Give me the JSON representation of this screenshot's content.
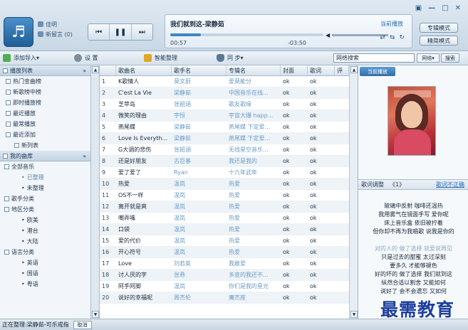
{
  "window": {
    "controls": [
      "▣",
      "—",
      "□",
      "✕"
    ],
    "mode_buttons": [
      "专辑模式",
      "精简模式"
    ]
  },
  "user": {
    "name": "佳明",
    "messages": "新留言 (0)"
  },
  "transport": {
    "prev": "⏮",
    "pause": "❚❚",
    "next": "⏭"
  },
  "now_playing": {
    "title": "我们就到这-梁静茹",
    "lyric_link": "当前播放",
    "time_elapsed": "00:57",
    "time_remaining": "-03:50",
    "progress": 0.2,
    "mode_icons": [
      "⇄",
      "⇆",
      "↻"
    ]
  },
  "toolbar": {
    "add_label": "添加导入▾",
    "settings_label": "设 置",
    "organize_label": "智能整理",
    "sync_label": "同 步▾",
    "search_value": "网络搜索",
    "search_scope": "网络▾",
    "search_button": "搜索"
  },
  "sidebar": {
    "playlist_header": "播放列表",
    "collapse": "»",
    "playlist_items": [
      "热门金曲榜",
      "新歌榜中榜",
      "即时播放榜",
      "最近播放",
      "最常播放",
      "最近添加",
      "新列表"
    ],
    "library_header": "我的曲库",
    "library_items": [
      {
        "label": "全部音乐",
        "level": 1
      },
      {
        "label": "已整理",
        "level": 2
      },
      {
        "label": "未整理",
        "level": 2
      },
      {
        "label": "歌手分类",
        "level": 1
      },
      {
        "label": "地区分类",
        "level": 1
      },
      {
        "label": "欧美",
        "level": 2
      },
      {
        "label": "港台",
        "level": 2
      },
      {
        "label": "大陆",
        "level": 2
      },
      {
        "label": "语言分类",
        "level": 1
      },
      {
        "label": "英语",
        "level": 2
      },
      {
        "label": "国语",
        "level": 2
      },
      {
        "label": "粤语",
        "level": 2
      }
    ]
  },
  "table": {
    "columns": [
      "歌曲名",
      "歌手名",
      "专辑名",
      "封面",
      "歌词",
      "评"
    ],
    "rows": [
      [
        "1",
        "K歌情人",
        "莫文蔚",
        "爱莫能分",
        "ok",
        "ok"
      ],
      [
        "2",
        "C'est La Vie",
        "梁静茹",
        "中国音乐在线...",
        "ok",
        "ok"
      ],
      [
        "3",
        "芝苹岛",
        "张韶涵",
        "歌友歌缘",
        "ok",
        "ok"
      ],
      [
        "4",
        "微笑的理由",
        "宇恒",
        "宇宙大爆 happ...",
        "ok",
        "ok"
      ],
      [
        "5",
        "燕尾蝶",
        "梁静茹",
        "燕尾蝶 下定爱...",
        "ok",
        "ok"
      ],
      [
        "6",
        "Love Is Everyth...",
        "梁静茹",
        "燕尾蝶 下定爱...",
        "ok",
        "ok"
      ],
      [
        "7",
        "G大调的悲伤",
        "张韶涵",
        "无线星空音乐...",
        "ok",
        "ok"
      ],
      [
        "8",
        "还是好朋友",
        "古巨基",
        "我还是我的",
        "ok",
        "ok"
      ],
      [
        "9",
        "爱了爱了",
        "Ryan",
        "十六年武年",
        "ok",
        "ok"
      ],
      [
        "10",
        "热爱",
        "温岚",
        "热爱",
        "ok",
        "ok"
      ],
      [
        "11",
        "OS不一样",
        "温岚",
        "热爱",
        "ok",
        "ok"
      ],
      [
        "12",
        "离开就是爽",
        "温岚",
        "热爱",
        "ok",
        "ok"
      ],
      [
        "13",
        "嘲弄嘴",
        "温岚",
        "热爱",
        "ok",
        "ok"
      ],
      [
        "14",
        "口袋",
        "温岚",
        "热爱",
        "ok",
        "ok"
      ],
      [
        "15",
        "爱的代价",
        "温岚",
        "热爱",
        "ok",
        "ok"
      ],
      [
        "16",
        "开心符号",
        "温岚",
        "热爱",
        "ok",
        "ok"
      ],
      [
        "17",
        "Love",
        "刘若英",
        "我敢爱",
        "ok",
        "ok"
      ],
      [
        "18",
        "讨人厌的字",
        "张悬",
        "多变的我还不...",
        "ok",
        "ok"
      ],
      [
        "19",
        "阿手阿脚",
        "温岚",
        "你们是我的星光",
        "ok",
        "ok"
      ],
      [
        "20",
        "说好的幸福呢",
        "周杰伦",
        "魔杰座",
        "ok",
        "ok"
      ]
    ]
  },
  "right_panel": {
    "tab": "当前播放",
    "lyric_header": "歌词调整",
    "lyric_arrows": "《1》",
    "lyric_link": "歌词不正确",
    "lyrics": [
      {
        "text": "玻璃中反射 咖啡还温热",
        "faint": false
      },
      {
        "text": "我用雾气在镜面手写 爱你呢",
        "faint": false
      },
      {
        "text": "床上音乐盒 依旧被拧着",
        "faint": false
      },
      {
        "text": "但你却不再为我唱歌 说我是你的",
        "faint": false
      },
      {
        "text": "",
        "faint": false
      },
      {
        "text": "对的人的 做了选择 就爱说再见",
        "faint": true
      },
      {
        "text": "只是过去的甜蜜 太过深刻",
        "faint": false
      },
      {
        "text": "要多久 才能够褪色",
        "faint": false
      },
      {
        "text": "好的坏的 做了选择 我们就到这",
        "faint": false
      },
      {
        "text": "纵然合适以割舍 又能如何",
        "faint": false
      },
      {
        "text": "说好了 会不会遗忘 又如何",
        "faint": false
      }
    ]
  },
  "status": {
    "text": "正在整理:梁静茹-可乐戒指",
    "cancel": "取消"
  },
  "watermark": "最需教育",
  "colors": {
    "accent": "#2f6ea8",
    "link": "#2a6fb8",
    "artist_text": "#6b9bc6"
  }
}
